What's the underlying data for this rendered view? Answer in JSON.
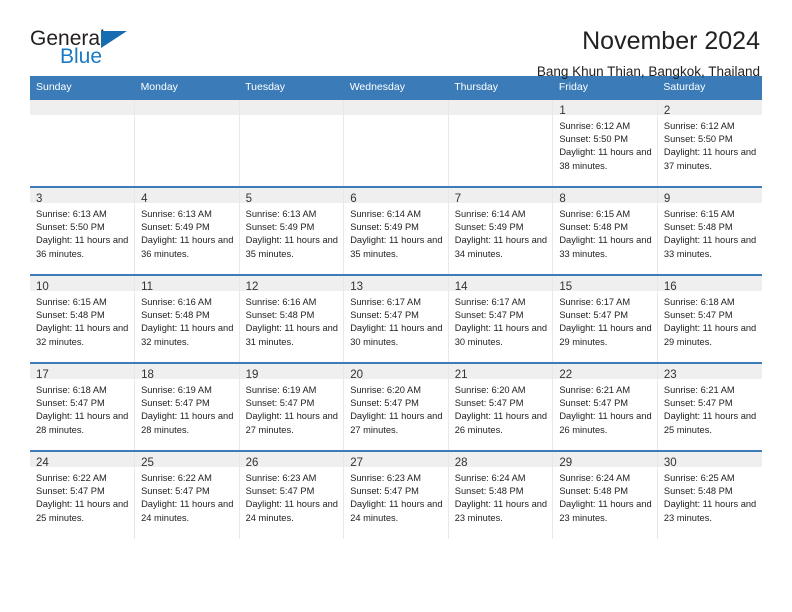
{
  "brand": {
    "name_part1": "General",
    "name_part2": "Blue",
    "triangle_color": "#156cb0",
    "blue_color": "#1b7ac4"
  },
  "header": {
    "month_title": "November 2024",
    "location": "Bang Khun Thian, Bangkok, Thailand"
  },
  "theme": {
    "header_blue": "#3b7cb8",
    "daynum_band": "#efeff0"
  },
  "weekday_headers": [
    "Sunday",
    "Monday",
    "Tuesday",
    "Wednesday",
    "Thursday",
    "Friday",
    "Saturday"
  ],
  "weeks": [
    [
      {
        "day": "",
        "sunrise": "",
        "sunset": "",
        "daylight": "",
        "empty": true
      },
      {
        "day": "",
        "sunrise": "",
        "sunset": "",
        "daylight": "",
        "empty": true
      },
      {
        "day": "",
        "sunrise": "",
        "sunset": "",
        "daylight": "",
        "empty": true
      },
      {
        "day": "",
        "sunrise": "",
        "sunset": "",
        "daylight": "",
        "empty": true
      },
      {
        "day": "",
        "sunrise": "",
        "sunset": "",
        "daylight": "",
        "empty": true
      },
      {
        "day": "1",
        "sunrise": "Sunrise: 6:12 AM",
        "sunset": "Sunset: 5:50 PM",
        "daylight": "Daylight: 11 hours and 38 minutes."
      },
      {
        "day": "2",
        "sunrise": "Sunrise: 6:12 AM",
        "sunset": "Sunset: 5:50 PM",
        "daylight": "Daylight: 11 hours and 37 minutes."
      }
    ],
    [
      {
        "day": "3",
        "sunrise": "Sunrise: 6:13 AM",
        "sunset": "Sunset: 5:50 PM",
        "daylight": "Daylight: 11 hours and 36 minutes."
      },
      {
        "day": "4",
        "sunrise": "Sunrise: 6:13 AM",
        "sunset": "Sunset: 5:49 PM",
        "daylight": "Daylight: 11 hours and 36 minutes."
      },
      {
        "day": "5",
        "sunrise": "Sunrise: 6:13 AM",
        "sunset": "Sunset: 5:49 PM",
        "daylight": "Daylight: 11 hours and 35 minutes."
      },
      {
        "day": "6",
        "sunrise": "Sunrise: 6:14 AM",
        "sunset": "Sunset: 5:49 PM",
        "daylight": "Daylight: 11 hours and 35 minutes."
      },
      {
        "day": "7",
        "sunrise": "Sunrise: 6:14 AM",
        "sunset": "Sunset: 5:49 PM",
        "daylight": "Daylight: 11 hours and 34 minutes."
      },
      {
        "day": "8",
        "sunrise": "Sunrise: 6:15 AM",
        "sunset": "Sunset: 5:48 PM",
        "daylight": "Daylight: 11 hours and 33 minutes."
      },
      {
        "day": "9",
        "sunrise": "Sunrise: 6:15 AM",
        "sunset": "Sunset: 5:48 PM",
        "daylight": "Daylight: 11 hours and 33 minutes."
      }
    ],
    [
      {
        "day": "10",
        "sunrise": "Sunrise: 6:15 AM",
        "sunset": "Sunset: 5:48 PM",
        "daylight": "Daylight: 11 hours and 32 minutes."
      },
      {
        "day": "11",
        "sunrise": "Sunrise: 6:16 AM",
        "sunset": "Sunset: 5:48 PM",
        "daylight": "Daylight: 11 hours and 32 minutes."
      },
      {
        "day": "12",
        "sunrise": "Sunrise: 6:16 AM",
        "sunset": "Sunset: 5:48 PM",
        "daylight": "Daylight: 11 hours and 31 minutes."
      },
      {
        "day": "13",
        "sunrise": "Sunrise: 6:17 AM",
        "sunset": "Sunset: 5:47 PM",
        "daylight": "Daylight: 11 hours and 30 minutes."
      },
      {
        "day": "14",
        "sunrise": "Sunrise: 6:17 AM",
        "sunset": "Sunset: 5:47 PM",
        "daylight": "Daylight: 11 hours and 30 minutes."
      },
      {
        "day": "15",
        "sunrise": "Sunrise: 6:17 AM",
        "sunset": "Sunset: 5:47 PM",
        "daylight": "Daylight: 11 hours and 29 minutes."
      },
      {
        "day": "16",
        "sunrise": "Sunrise: 6:18 AM",
        "sunset": "Sunset: 5:47 PM",
        "daylight": "Daylight: 11 hours and 29 minutes."
      }
    ],
    [
      {
        "day": "17",
        "sunrise": "Sunrise: 6:18 AM",
        "sunset": "Sunset: 5:47 PM",
        "daylight": "Daylight: 11 hours and 28 minutes."
      },
      {
        "day": "18",
        "sunrise": "Sunrise: 6:19 AM",
        "sunset": "Sunset: 5:47 PM",
        "daylight": "Daylight: 11 hours and 28 minutes."
      },
      {
        "day": "19",
        "sunrise": "Sunrise: 6:19 AM",
        "sunset": "Sunset: 5:47 PM",
        "daylight": "Daylight: 11 hours and 27 minutes."
      },
      {
        "day": "20",
        "sunrise": "Sunrise: 6:20 AM",
        "sunset": "Sunset: 5:47 PM",
        "daylight": "Daylight: 11 hours and 27 minutes."
      },
      {
        "day": "21",
        "sunrise": "Sunrise: 6:20 AM",
        "sunset": "Sunset: 5:47 PM",
        "daylight": "Daylight: 11 hours and 26 minutes."
      },
      {
        "day": "22",
        "sunrise": "Sunrise: 6:21 AM",
        "sunset": "Sunset: 5:47 PM",
        "daylight": "Daylight: 11 hours and 26 minutes."
      },
      {
        "day": "23",
        "sunrise": "Sunrise: 6:21 AM",
        "sunset": "Sunset: 5:47 PM",
        "daylight": "Daylight: 11 hours and 25 minutes."
      }
    ],
    [
      {
        "day": "24",
        "sunrise": "Sunrise: 6:22 AM",
        "sunset": "Sunset: 5:47 PM",
        "daylight": "Daylight: 11 hours and 25 minutes."
      },
      {
        "day": "25",
        "sunrise": "Sunrise: 6:22 AM",
        "sunset": "Sunset: 5:47 PM",
        "daylight": "Daylight: 11 hours and 24 minutes."
      },
      {
        "day": "26",
        "sunrise": "Sunrise: 6:23 AM",
        "sunset": "Sunset: 5:47 PM",
        "daylight": "Daylight: 11 hours and 24 minutes."
      },
      {
        "day": "27",
        "sunrise": "Sunrise: 6:23 AM",
        "sunset": "Sunset: 5:47 PM",
        "daylight": "Daylight: 11 hours and 24 minutes."
      },
      {
        "day": "28",
        "sunrise": "Sunrise: 6:24 AM",
        "sunset": "Sunset: 5:48 PM",
        "daylight": "Daylight: 11 hours and 23 minutes."
      },
      {
        "day": "29",
        "sunrise": "Sunrise: 6:24 AM",
        "sunset": "Sunset: 5:48 PM",
        "daylight": "Daylight: 11 hours and 23 minutes."
      },
      {
        "day": "30",
        "sunrise": "Sunrise: 6:25 AM",
        "sunset": "Sunset: 5:48 PM",
        "daylight": "Daylight: 11 hours and 23 minutes."
      }
    ]
  ]
}
